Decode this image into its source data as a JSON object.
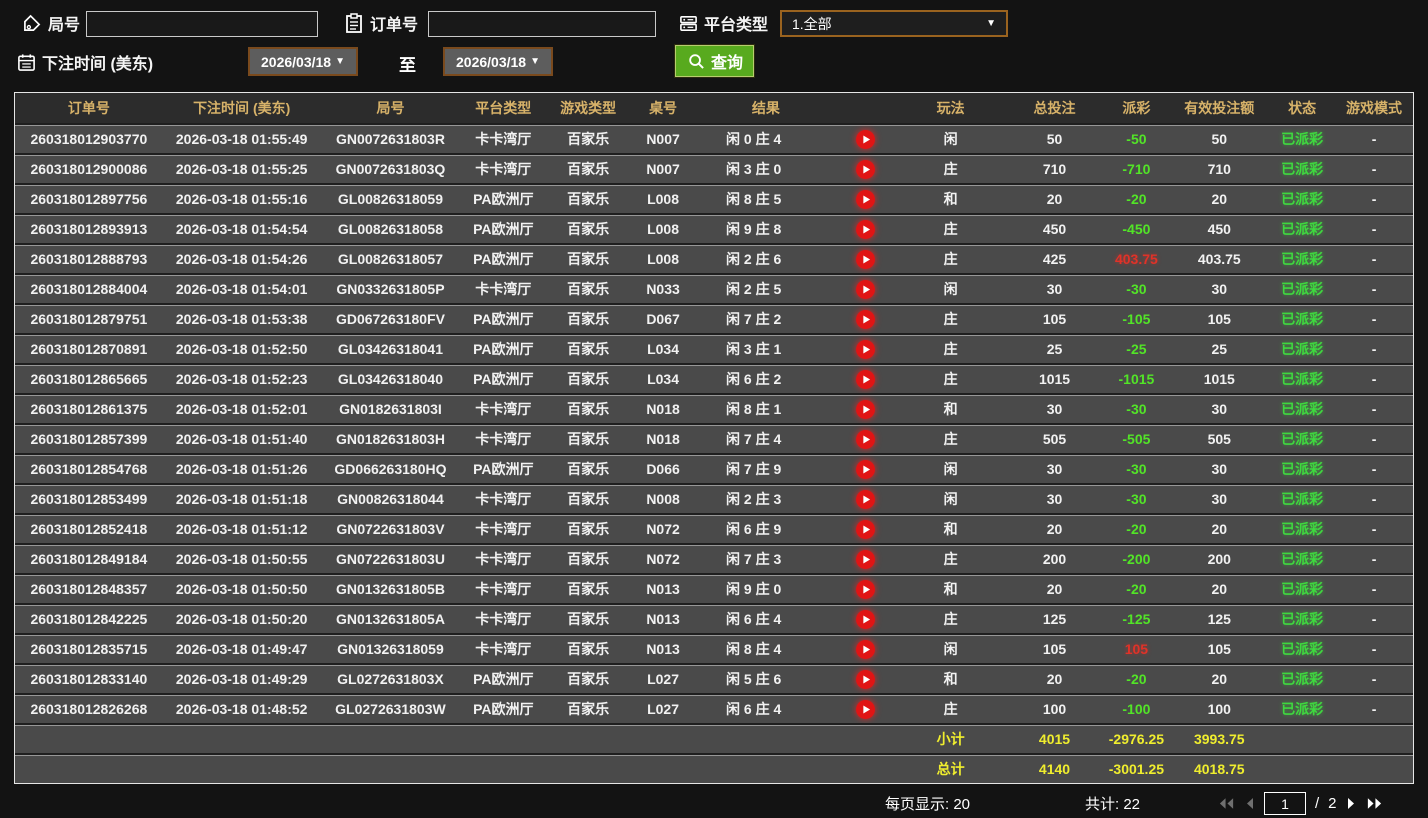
{
  "filters": {
    "round_label": "局号",
    "round_value": "",
    "order_label": "订单号",
    "order_value": "",
    "platform_label": "平台类型",
    "platform_value": "1.全部",
    "bet_time_label": "下注时间 (美东)",
    "date_from": "2026/03/18",
    "to_label": "至",
    "date_to": "2026/03/18",
    "search_label": "查询"
  },
  "icons": {
    "round": "tag-icon",
    "order": "clipboard-icon",
    "platform": "server-icon",
    "bet_time": "calendar-icon",
    "search": "magnifier-icon",
    "result_video": "play-icon"
  },
  "table": {
    "columns": [
      "订单号",
      "下注时间 (美东)",
      "局号",
      "平台类型",
      "游戏类型",
      "桌号",
      "结果",
      "",
      "玩法",
      "总投注",
      "派彩",
      "有效投注额",
      "状态",
      "游戏模式"
    ],
    "rows": [
      [
        "260318012903770",
        "2026-03-18 01:55:49",
        "GN0072631803R",
        "卡卡湾厅",
        "百家乐",
        "N007",
        "闲 0 庄 4",
        "闲",
        "50",
        "-50",
        "50",
        "已派彩",
        "-"
      ],
      [
        "260318012900086",
        "2026-03-18 01:55:25",
        "GN0072631803Q",
        "卡卡湾厅",
        "百家乐",
        "N007",
        "闲 3 庄 0",
        "庄",
        "710",
        "-710",
        "710",
        "已派彩",
        "-"
      ],
      [
        "260318012897756",
        "2026-03-18 01:55:16",
        "GL00826318059",
        "PA欧洲厅",
        "百家乐",
        "L008",
        "闲 8 庄 5",
        "和",
        "20",
        "-20",
        "20",
        "已派彩",
        "-"
      ],
      [
        "260318012893913",
        "2026-03-18 01:54:54",
        "GL00826318058",
        "PA欧洲厅",
        "百家乐",
        "L008",
        "闲 9 庄 8",
        "庄",
        "450",
        "-450",
        "450",
        "已派彩",
        "-"
      ],
      [
        "260318012888793",
        "2026-03-18 01:54:26",
        "GL00826318057",
        "PA欧洲厅",
        "百家乐",
        "L008",
        "闲 2 庄 6",
        "庄",
        "425",
        "403.75",
        "403.75",
        "已派彩",
        "-"
      ],
      [
        "260318012884004",
        "2026-03-18 01:54:01",
        "GN0332631805P",
        "卡卡湾厅",
        "百家乐",
        "N033",
        "闲 2 庄 5",
        "闲",
        "30",
        "-30",
        "30",
        "已派彩",
        "-"
      ],
      [
        "260318012879751",
        "2026-03-18 01:53:38",
        "GD067263180FV",
        "PA欧洲厅",
        "百家乐",
        "D067",
        "闲 7 庄 2",
        "庄",
        "105",
        "-105",
        "105",
        "已派彩",
        "-"
      ],
      [
        "260318012870891",
        "2026-03-18 01:52:50",
        "GL03426318041",
        "PA欧洲厅",
        "百家乐",
        "L034",
        "闲 3 庄 1",
        "庄",
        "25",
        "-25",
        "25",
        "已派彩",
        "-"
      ],
      [
        "260318012865665",
        "2026-03-18 01:52:23",
        "GL03426318040",
        "PA欧洲厅",
        "百家乐",
        "L034",
        "闲 6 庄 2",
        "庄",
        "1015",
        "-1015",
        "1015",
        "已派彩",
        "-"
      ],
      [
        "260318012861375",
        "2026-03-18 01:52:01",
        "GN0182631803I",
        "卡卡湾厅",
        "百家乐",
        "N018",
        "闲 8 庄 1",
        "和",
        "30",
        "-30",
        "30",
        "已派彩",
        "-"
      ],
      [
        "260318012857399",
        "2026-03-18 01:51:40",
        "GN0182631803H",
        "卡卡湾厅",
        "百家乐",
        "N018",
        "闲 7 庄 4",
        "庄",
        "505",
        "-505",
        "505",
        "已派彩",
        "-"
      ],
      [
        "260318012854768",
        "2026-03-18 01:51:26",
        "GD066263180HQ",
        "PA欧洲厅",
        "百家乐",
        "D066",
        "闲 7 庄 9",
        "闲",
        "30",
        "-30",
        "30",
        "已派彩",
        "-"
      ],
      [
        "260318012853499",
        "2026-03-18 01:51:18",
        "GN00826318044",
        "卡卡湾厅",
        "百家乐",
        "N008",
        "闲 2 庄 3",
        "闲",
        "30",
        "-30",
        "30",
        "已派彩",
        "-"
      ],
      [
        "260318012852418",
        "2026-03-18 01:51:12",
        "GN0722631803V",
        "卡卡湾厅",
        "百家乐",
        "N072",
        "闲 6 庄 9",
        "和",
        "20",
        "-20",
        "20",
        "已派彩",
        "-"
      ],
      [
        "260318012849184",
        "2026-03-18 01:50:55",
        "GN0722631803U",
        "卡卡湾厅",
        "百家乐",
        "N072",
        "闲 7 庄 3",
        "庄",
        "200",
        "-200",
        "200",
        "已派彩",
        "-"
      ],
      [
        "260318012848357",
        "2026-03-18 01:50:50",
        "GN0132631805B",
        "卡卡湾厅",
        "百家乐",
        "N013",
        "闲 9 庄 0",
        "和",
        "20",
        "-20",
        "20",
        "已派彩",
        "-"
      ],
      [
        "260318012842225",
        "2026-03-18 01:50:20",
        "GN0132631805A",
        "卡卡湾厅",
        "百家乐",
        "N013",
        "闲 6 庄 4",
        "庄",
        "125",
        "-125",
        "125",
        "已派彩",
        "-"
      ],
      [
        "260318012835715",
        "2026-03-18 01:49:47",
        "GN01326318059",
        "卡卡湾厅",
        "百家乐",
        "N013",
        "闲 8 庄 4",
        "闲",
        "105",
        "105",
        "105",
        "已派彩",
        "-"
      ],
      [
        "260318012833140",
        "2026-03-18 01:49:29",
        "GL0272631803X",
        "PA欧洲厅",
        "百家乐",
        "L027",
        "闲 5 庄 6",
        "和",
        "20",
        "-20",
        "20",
        "已派彩",
        "-"
      ],
      [
        "260318012826268",
        "2026-03-18 01:48:52",
        "GL0272631803W",
        "PA欧洲厅",
        "百家乐",
        "L027",
        "闲 6 庄 4",
        "庄",
        "100",
        "-100",
        "100",
        "已派彩",
        "-"
      ]
    ],
    "subtotal": {
      "label": "小计",
      "total_bet": "4015",
      "payout": "-2976.25",
      "valid_bet": "3993.75"
    },
    "grand_total": {
      "label": "总计",
      "total_bet": "4140",
      "payout": "-3001.25",
      "valid_bet": "4018.75"
    }
  },
  "footer": {
    "per_page": "每页显示: 20",
    "total_count": "共计: 22",
    "page": "1",
    "page_sep": "/",
    "total_pages": "2"
  },
  "colors": {
    "background": "#131313",
    "row_bg": "#4a4a4a",
    "header_bg": "#2c2c2c",
    "header_text": "#d7b269",
    "payout_negative": "#52e427",
    "payout_positive": "#e03228",
    "status_green": "#3fd83f",
    "totals_yellow": "#f0ee2e",
    "search_green": "#58aa1e",
    "date_border_brown": "#7a4a1d",
    "select_border_orange": "#9a631f",
    "play_red": "#e01414"
  }
}
